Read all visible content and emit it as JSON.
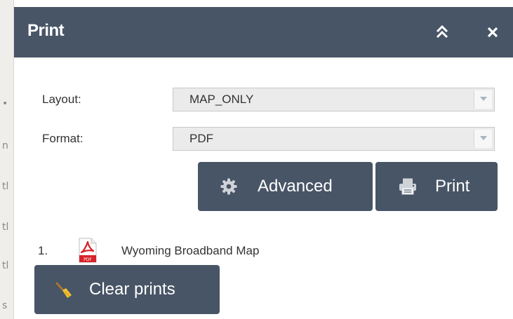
{
  "panel": {
    "title": "Print",
    "collapse_icon": "double-chevron-up-icon",
    "close_icon": "close-icon"
  },
  "form": {
    "layout": {
      "label": "Layout:",
      "value": "MAP_ONLY"
    },
    "format": {
      "label": "Format:",
      "value": "PDF"
    }
  },
  "buttons": {
    "advanced": {
      "label": "Advanced",
      "icon": "gear-icon"
    },
    "print": {
      "label": "Print",
      "icon": "printer-icon"
    },
    "clear": {
      "label": "Clear prints",
      "icon": "broom-icon"
    }
  },
  "results": [
    {
      "index": "1.",
      "icon": "pdf-file-icon",
      "title": "Wyoming Broadband Map"
    }
  ],
  "colors": {
    "header": "#485566",
    "button": "#485566",
    "select_bg": "#ebebeb",
    "text": "#333333"
  }
}
